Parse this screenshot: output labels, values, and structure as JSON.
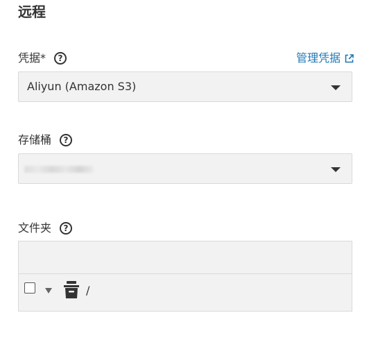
{
  "section": {
    "title": "远程"
  },
  "credentials": {
    "label": "凭据*",
    "manage_link": "管理凭据",
    "selected": "Aliyun (Amazon S3)"
  },
  "bucket": {
    "label": "存储桶"
  },
  "folder": {
    "label": "文件夹",
    "input_value": "",
    "tree": {
      "root_label": "/"
    }
  },
  "colors": {
    "link": "#1f78b4",
    "field_bg": "#f2f2f2",
    "border": "#d9d9d9"
  },
  "icons": [
    "help-icon",
    "external-link-icon",
    "dropdown-caret-icon",
    "tree-expand-icon",
    "bucket-icon"
  ]
}
